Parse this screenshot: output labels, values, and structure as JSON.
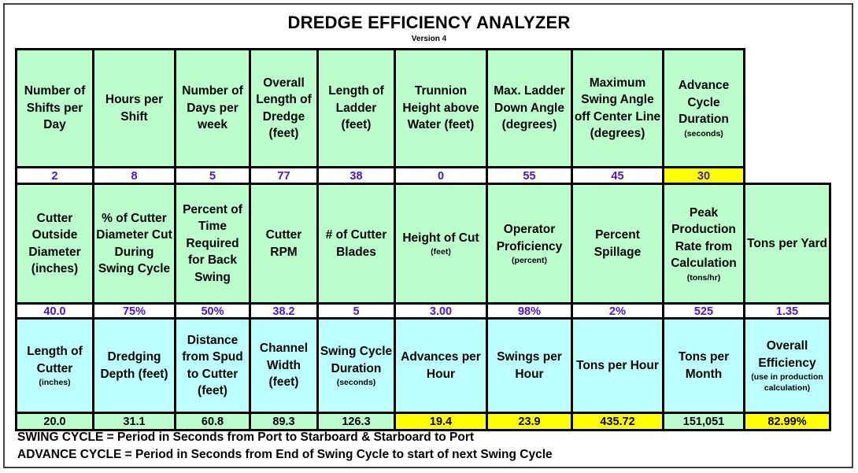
{
  "header": {
    "title": "DREDGE EFFICIENCY ANALYZER",
    "version": "Version 4"
  },
  "colors": {
    "header_green": "#bbffcc",
    "header_cyan": "#bbffff",
    "highlight_yellow": "#ffff00",
    "input_value_text": "#4b16d6",
    "border": "#000000"
  },
  "section1": {
    "fields": [
      {
        "label": "Number of Shifts per Day",
        "unit": "",
        "value": "2"
      },
      {
        "label": "Hours per Shift",
        "unit": "",
        "value": "8"
      },
      {
        "label": "Number of Days per week",
        "unit": "",
        "value": "5"
      },
      {
        "label": "Overall Length of Dredge (feet)",
        "unit": "",
        "value": "77"
      },
      {
        "label": "Length of Ladder (feet)",
        "unit": "",
        "value": "38"
      },
      {
        "label": "Trunnion Height above Water (feet)",
        "unit": "",
        "value": "0"
      },
      {
        "label": "Max. Ladder Down Angle (degrees)",
        "unit": "",
        "value": "55"
      },
      {
        "label": "Maximum Swing Angle off Center Line (degrees)",
        "unit": "",
        "value": "45"
      },
      {
        "label": "Advance Cycle Duration",
        "unit": "(seconds)",
        "value": "30"
      }
    ]
  },
  "section2": {
    "fields": [
      {
        "label": "Cutter Outside Diameter (inches)",
        "unit": "",
        "value": "40.0"
      },
      {
        "label": "% of Cutter Diameter Cut During Swing Cycle",
        "unit": "",
        "value": "75%"
      },
      {
        "label": "Percent of Time Required for Back Swing",
        "unit": "",
        "value": "50%"
      },
      {
        "label": "Cutter RPM",
        "unit": "",
        "value": "38.2"
      },
      {
        "label": "# of Cutter Blades",
        "unit": "",
        "value": "5"
      },
      {
        "label": "Height of Cut",
        "unit": "(feet)",
        "value": "3.00"
      },
      {
        "label": "Operator Proficiency",
        "unit": "(percent)",
        "value": "98%"
      },
      {
        "label": "Percent Spillage",
        "unit": "",
        "value": "2%"
      },
      {
        "label": "Peak Production Rate from Calculation",
        "unit": "(tons/hr)",
        "value": "525"
      },
      {
        "label": "Tons per Yard",
        "unit": "",
        "value": "1.35"
      }
    ]
  },
  "section3": {
    "fields": [
      {
        "label": "Length of Cutter",
        "unit": "(inches)",
        "value": "20.0"
      },
      {
        "label": "Dredging Depth (feet)",
        "unit": "",
        "value": "31.1"
      },
      {
        "label": "Distance from Spud to Cutter (feet)",
        "unit": "",
        "value": "60.8"
      },
      {
        "label": "Channel Width (feet)",
        "unit": "",
        "value": "89.3"
      },
      {
        "label": "Swing Cycle Duration",
        "unit": "(seconds)",
        "value": "126.3"
      },
      {
        "label": "Advances per Hour",
        "unit": "",
        "value": "19.4"
      },
      {
        "label": "Swings per Hour",
        "unit": "",
        "value": "23.9"
      },
      {
        "label": "Tons per Hour",
        "unit": "",
        "value": "435.72"
      },
      {
        "label": "Tons per Month",
        "unit": "",
        "value": "151,051"
      },
      {
        "label": "Overall Efficiency",
        "unit": "(use in production calculation)",
        "value": "82.99%"
      }
    ]
  },
  "notes": {
    "swing_cycle": "SWING CYCLE = Period in Seconds from Port to Starboard & Starboard to Port",
    "advance_cycle": "ADVANCE CYCLE = Period in Seconds from End of Swing Cycle to start of next Swing Cycle"
  }
}
